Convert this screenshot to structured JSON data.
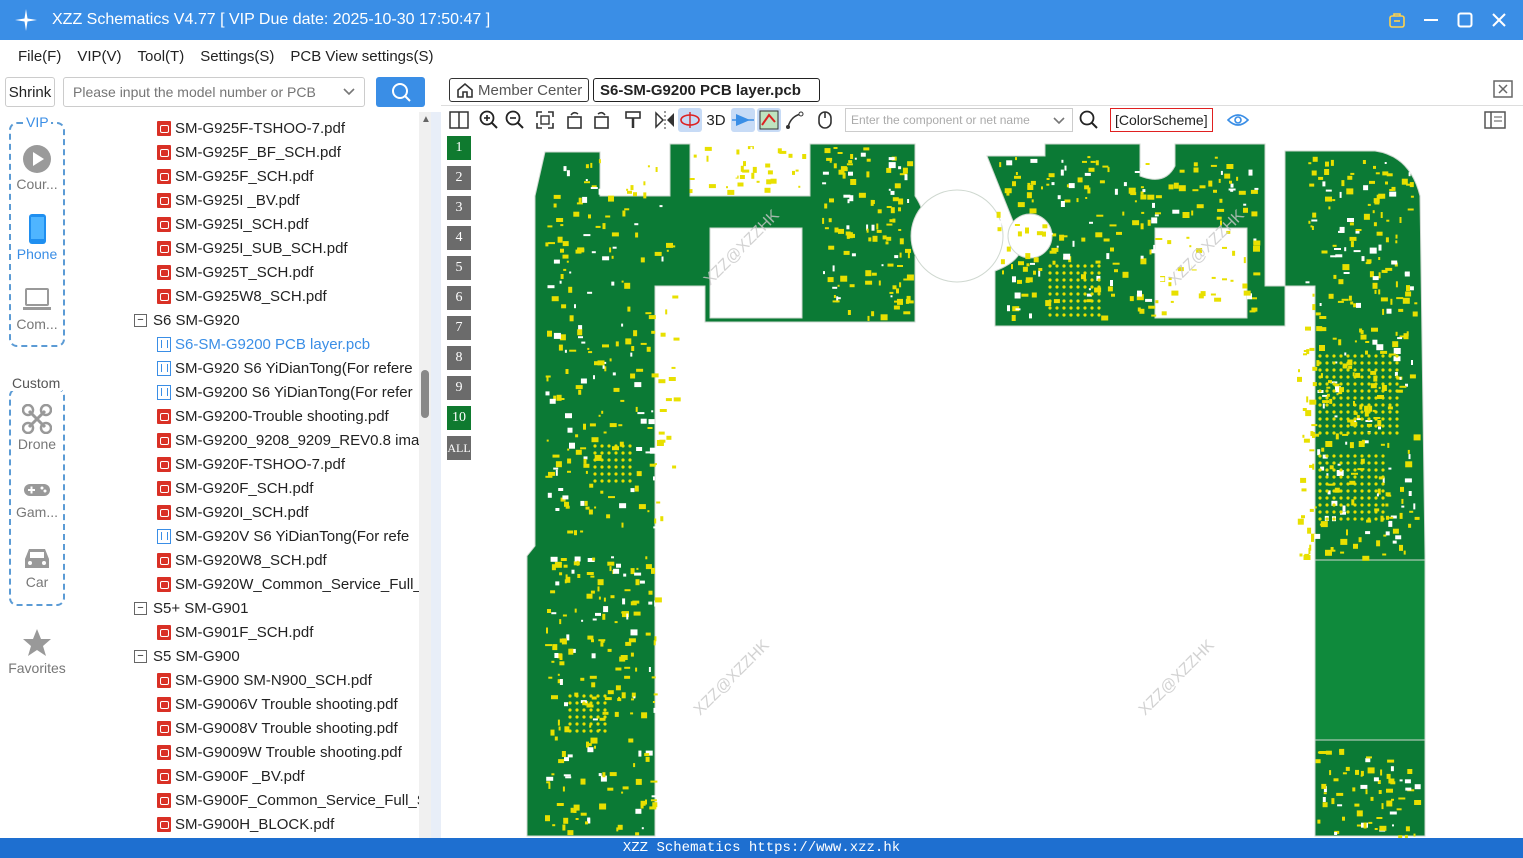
{
  "window": {
    "title": "XZZ Schematics V4.77 [ VIP Due date: 2025-10-30 17:50:47 ]"
  },
  "menu": [
    "File(F)",
    "VIP(V)",
    "Tool(T)",
    "Settings(S)",
    "PCB View settings(S)"
  ],
  "search": {
    "shrink_label": "Shrink",
    "placeholder": "Please input the model number or PCB"
  },
  "nav": {
    "vip_group": "VIP",
    "custom_group": "Custom",
    "items": [
      {
        "label": "Cour...",
        "icon": "play-circle-icon"
      },
      {
        "label": "Phone",
        "icon": "phone-icon"
      },
      {
        "label": "Com...",
        "icon": "laptop-icon"
      },
      {
        "label": "Drone",
        "icon": "drone-icon"
      },
      {
        "label": "Gam...",
        "icon": "gamepad-icon"
      },
      {
        "label": "Car",
        "icon": "car-icon"
      },
      {
        "label": "Favorites",
        "icon": "star-icon"
      }
    ]
  },
  "tree": [
    {
      "type": "pdf",
      "label": "SM-G925F-TSHOO-7.pdf"
    },
    {
      "type": "pdf",
      "label": "SM-G925F_BF_SCH.pdf"
    },
    {
      "type": "pdf",
      "label": "SM-G925F_SCH.pdf"
    },
    {
      "type": "pdf",
      "label": "SM-G925I _BV.pdf"
    },
    {
      "type": "pdf",
      "label": "SM-G925I_SCH.pdf"
    },
    {
      "type": "pdf",
      "label": "SM-G925I_SUB_SCH.pdf"
    },
    {
      "type": "pdf",
      "label": "SM-G925T_SCH.pdf"
    },
    {
      "type": "pdf",
      "label": "SM-G925W8_SCH.pdf"
    },
    {
      "type": "folder",
      "label": "S6 SM-G920"
    },
    {
      "type": "pcb",
      "label": "S6-SM-G9200 PCB layer.pcb",
      "selected": true
    },
    {
      "type": "pcb",
      "label": "SM-G920 S6 YiDianTong(For refere"
    },
    {
      "type": "pcb",
      "label": "SM-G9200 S6 YiDianTong(For refer"
    },
    {
      "type": "pdf",
      "label": "SM-G9200-Trouble shooting.pdf"
    },
    {
      "type": "pdf",
      "label": "SM-G9200_9208_9209_REV0.8 imag"
    },
    {
      "type": "pdf",
      "label": "SM-G920F-TSHOO-7.pdf"
    },
    {
      "type": "pdf",
      "label": "SM-G920F_SCH.pdf"
    },
    {
      "type": "pdf",
      "label": "SM-G920I_SCH.pdf"
    },
    {
      "type": "pcb",
      "label": "SM-G920V S6 YiDianTong(For refe"
    },
    {
      "type": "pdf",
      "label": "SM-G920W8_SCH.pdf"
    },
    {
      "type": "pdf",
      "label": "SM-G920W_Common_Service_Full_"
    },
    {
      "type": "folder",
      "label": "S5+ SM-G901"
    },
    {
      "type": "pdf",
      "label": "SM-G901F_SCH.pdf"
    },
    {
      "type": "folder",
      "label": "S5 SM-G900"
    },
    {
      "type": "pdf",
      "label": "SM-G900 SM-N900_SCH.pdf"
    },
    {
      "type": "pdf",
      "label": "SM-G9006V Trouble shooting.pdf"
    },
    {
      "type": "pdf",
      "label": "SM-G9008V Trouble shooting.pdf"
    },
    {
      "type": "pdf",
      "label": "SM-G9009W Trouble shooting.pdf"
    },
    {
      "type": "pdf",
      "label": "SM-G900F _BV.pdf"
    },
    {
      "type": "pdf",
      "label": "SM-G900F_Common_Service_Full_S"
    },
    {
      "type": "pdf",
      "label": "SM-G900H_BLOCK.pdf"
    }
  ],
  "tabs": {
    "member": "Member Center",
    "active": "S6-SM-G9200 PCB layer.pcb"
  },
  "toolbar": {
    "three_d": "3D",
    "component_placeholder": "Enter the component or net name",
    "color_scheme": "[ColorScheme]"
  },
  "layers": [
    "1",
    "2",
    "3",
    "4",
    "5",
    "6",
    "7",
    "8",
    "9",
    "10",
    "ALL"
  ],
  "active_layers": [
    "1",
    "10"
  ],
  "watermark": "XZZ@XZZHK",
  "status": "XZZ Schematics https://www.xzz.hk",
  "colors": {
    "titlebar": "#3a8ee6",
    "statusbar": "#1e6fd0",
    "pcb_green": "#0b7a35",
    "pad_yellow": "#e8e000",
    "accent": "#3a8ee6"
  }
}
